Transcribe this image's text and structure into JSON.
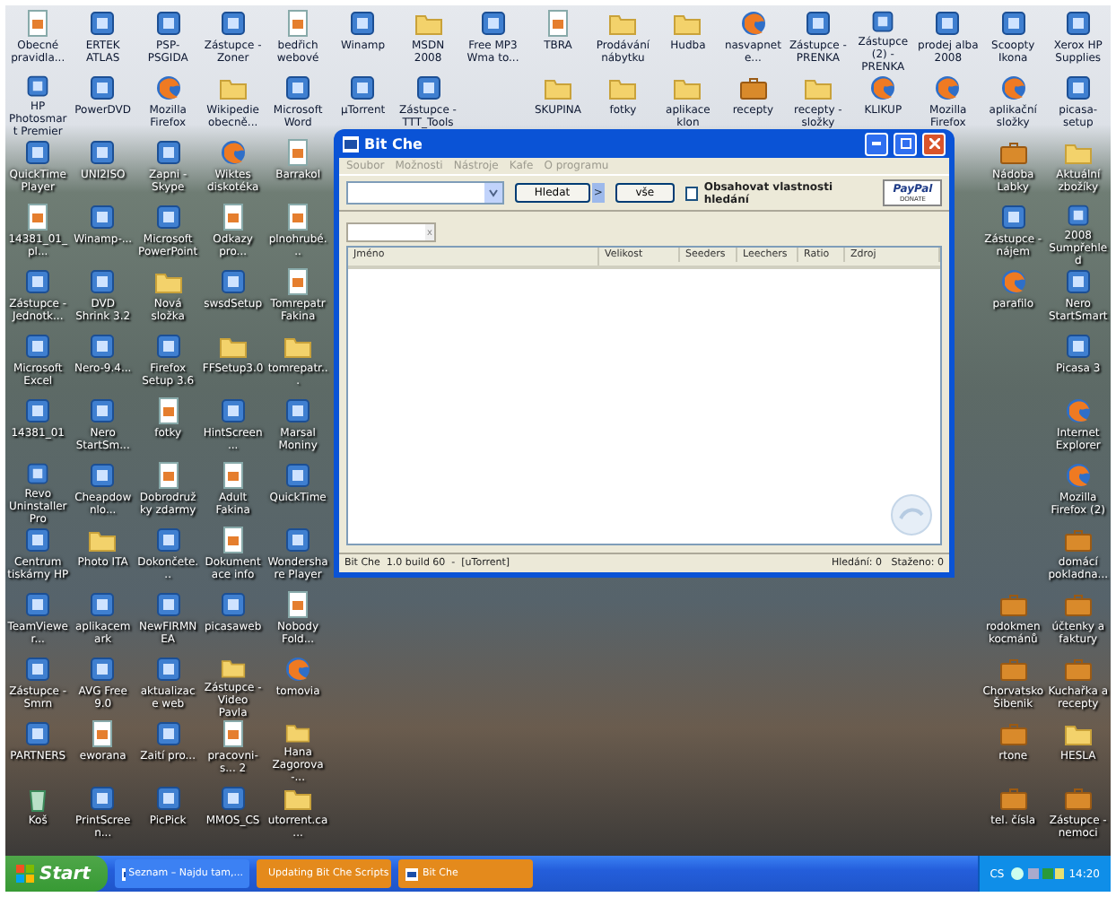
{
  "desktop": {
    "rows": [
      [
        {
          "label": "Obecné pravidla...",
          "kind": "document"
        },
        {
          "label": "ERTEK ATLAS",
          "kind": "program"
        },
        {
          "label": "PSP-PSGIDA",
          "kind": "program"
        },
        {
          "label": "Zástupce - Zoner",
          "kind": "program"
        },
        {
          "label": "bedřich webové",
          "kind": "document"
        },
        {
          "label": "Winamp",
          "kind": "program"
        },
        {
          "label": "MSDN 2008",
          "kind": "folder"
        },
        {
          "label": "Free MP3 Wma to...",
          "kind": "program"
        },
        {
          "label": "TBRA",
          "kind": "document"
        },
        {
          "label": "Prodávání nábytku",
          "kind": "folder"
        },
        {
          "label": "Hudba",
          "kind": "folder"
        },
        {
          "label": "nasvapnete...",
          "kind": "browser"
        },
        {
          "label": "Zástupce - PRENKA",
          "kind": "program"
        },
        {
          "label": "Zástupce (2) - PRENKA",
          "kind": "program"
        },
        {
          "label": "prodej alba 2008",
          "kind": "program"
        },
        {
          "label": "Scoopty Ikona",
          "kind": "program"
        },
        {
          "label": "Xerox HP Supplies",
          "kind": "program"
        }
      ],
      [
        {
          "label": "HP Photosmart Premier",
          "kind": "program"
        },
        {
          "label": "PowerDVD",
          "kind": "program"
        },
        {
          "label": "Mozilla Firefox",
          "kind": "browser"
        },
        {
          "label": "Wikipedie obecně...",
          "kind": "folder"
        },
        {
          "label": "Microsoft Word",
          "kind": "program"
        },
        {
          "label": "µTorrent",
          "kind": "program"
        },
        {
          "label": "Zástupce - TTT_Tools",
          "kind": "program"
        },
        null,
        {
          "label": "SKUPINA",
          "kind": "folder"
        },
        {
          "label": "fotky",
          "kind": "folder"
        },
        {
          "label": "aplikace klon",
          "kind": "folder"
        },
        {
          "label": "recepty",
          "kind": "briefcase"
        },
        {
          "label": "recepty - složky",
          "kind": "folder"
        },
        {
          "label": "KLIKUP",
          "kind": "browser"
        },
        {
          "label": "Mozilla Firefox",
          "kind": "browser"
        },
        {
          "label": "aplikační složky",
          "kind": "browser"
        },
        {
          "label": "picasa-setup",
          "kind": "program"
        }
      ],
      [
        {
          "label": "QuickTime Player",
          "kind": "program"
        },
        {
          "label": "UNI2ISO",
          "kind": "program"
        },
        {
          "label": "Zapni - Skype",
          "kind": "program"
        },
        {
          "label": "Wiktes diskotéka",
          "kind": "browser"
        },
        {
          "label": "Barrakol",
          "kind": "document"
        },
        null,
        null,
        null,
        null,
        null,
        null,
        null,
        null,
        null,
        null,
        {
          "label": "Nádoba Labky",
          "kind": "briefcase"
        },
        {
          "label": "Aktuální zbožíky",
          "kind": "folder"
        }
      ],
      [
        {
          "label": "14381_01_pl...",
          "kind": "document"
        },
        {
          "label": "Winamp-...",
          "kind": "program"
        },
        {
          "label": "Microsoft PowerPoint",
          "kind": "program"
        },
        {
          "label": "Odkazy pro...",
          "kind": "document"
        },
        {
          "label": "plnohrubé...",
          "kind": "document"
        },
        null,
        null,
        null,
        null,
        null,
        null,
        null,
        null,
        null,
        null,
        {
          "label": "Zástupce - nájem",
          "kind": "program"
        },
        {
          "label": "2008 Sumpřehled",
          "kind": "program"
        }
      ],
      [
        {
          "label": "Zástupce - Jednotk...",
          "kind": "program"
        },
        {
          "label": "DVD Shrink 3.2",
          "kind": "program"
        },
        {
          "label": "Nová složka",
          "kind": "folder"
        },
        {
          "label": "swsdSetup",
          "kind": "program"
        },
        {
          "label": "Tomrepatr Fakina",
          "kind": "document"
        },
        null,
        null,
        null,
        null,
        null,
        null,
        null,
        null,
        null,
        null,
        {
          "label": "parafilo",
          "kind": "browser"
        },
        {
          "label": "Nero StartSmart",
          "kind": "program"
        }
      ],
      [
        {
          "label": "Microsoft Excel",
          "kind": "program"
        },
        {
          "label": "Nero-9.4...",
          "kind": "program"
        },
        {
          "label": "Firefox Setup 3.6",
          "kind": "program"
        },
        {
          "label": "FFSetup3.0",
          "kind": "folder"
        },
        {
          "label": "tomrepatr...",
          "kind": "folder"
        },
        null,
        null,
        null,
        null,
        null,
        null,
        null,
        null,
        null,
        null,
        null,
        {
          "label": "Picasa 3",
          "kind": "program"
        }
      ],
      [
        {
          "label": "14381_01",
          "kind": "program"
        },
        {
          "label": "Nero StartSm...",
          "kind": "program"
        },
        {
          "label": "fotky",
          "kind": "document"
        },
        {
          "label": "HintScreen...",
          "kind": "program"
        },
        {
          "label": "Marsal Moniny",
          "kind": "program"
        },
        null,
        null,
        null,
        null,
        null,
        null,
        null,
        null,
        null,
        null,
        null,
        {
          "label": "Internet Explorer",
          "kind": "browser"
        }
      ],
      [
        {
          "label": "Revo Uninstaller Pro",
          "kind": "program"
        },
        {
          "label": "Cheapdownlo...",
          "kind": "program"
        },
        {
          "label": "Dobrodružky zdarmy",
          "kind": "document"
        },
        {
          "label": "Adult Fakina",
          "kind": "document"
        },
        {
          "label": "QuickTime",
          "kind": "program"
        },
        null,
        null,
        null,
        null,
        null,
        null,
        null,
        null,
        null,
        null,
        null,
        {
          "label": "Mozilla Firefox (2)",
          "kind": "browser"
        }
      ],
      [
        {
          "label": "Centrum tiskárny HP",
          "kind": "program"
        },
        {
          "label": "Photo ITA",
          "kind": "folder"
        },
        {
          "label": "Dokončete...",
          "kind": "program"
        },
        {
          "label": "Dokumentace info",
          "kind": "document"
        },
        {
          "label": "Wondershare Player",
          "kind": "program"
        },
        null,
        null,
        null,
        null,
        null,
        null,
        null,
        null,
        null,
        null,
        null,
        {
          "label": "domácí pokladna...",
          "kind": "briefcase"
        }
      ],
      [
        {
          "label": "TeamViewer...",
          "kind": "program"
        },
        {
          "label": "aplikacemark",
          "kind": "program"
        },
        {
          "label": "NewFIRMNEA",
          "kind": "program"
        },
        {
          "label": "picasaweb",
          "kind": "program"
        },
        {
          "label": "Nobody Fold...",
          "kind": "document"
        },
        null,
        null,
        null,
        null,
        null,
        null,
        null,
        null,
        null,
        null,
        {
          "label": "rodokmen kocmánů",
          "kind": "briefcase"
        },
        {
          "label": "účtenky a faktury",
          "kind": "briefcase"
        }
      ],
      [
        {
          "label": "Zástupce - Smrn",
          "kind": "program"
        },
        {
          "label": "AVG Free 9.0",
          "kind": "program"
        },
        {
          "label": "aktualizace web",
          "kind": "program"
        },
        {
          "label": "Zástupce - Video Pavla",
          "kind": "folder"
        },
        {
          "label": "tomovia",
          "kind": "browser"
        },
        null,
        null,
        null,
        null,
        null,
        null,
        null,
        null,
        null,
        null,
        {
          "label": "Chorvatsko Šibenik",
          "kind": "briefcase"
        },
        {
          "label": "Kuchařka a recepty",
          "kind": "briefcase"
        }
      ],
      [
        {
          "label": "PARTNERS",
          "kind": "program"
        },
        {
          "label": "eworana",
          "kind": "document"
        },
        {
          "label": "Zaití pro...",
          "kind": "program"
        },
        {
          "label": "pracovni-s... 2",
          "kind": "document"
        },
        {
          "label": "Hana Zagorova -...",
          "kind": "folder"
        },
        null,
        null,
        null,
        null,
        null,
        null,
        null,
        null,
        null,
        null,
        {
          "label": "rtone",
          "kind": "briefcase"
        },
        {
          "label": "HESLA",
          "kind": "folder"
        }
      ],
      [
        {
          "label": "Koš",
          "kind": "recycle"
        },
        {
          "label": "PrintScreen...",
          "kind": "program"
        },
        {
          "label": "PicPick",
          "kind": "program"
        },
        {
          "label": "MMOS_CS",
          "kind": "program"
        },
        {
          "label": "utorrent.ca...",
          "kind": "folder"
        },
        null,
        null,
        null,
        null,
        null,
        null,
        null,
        null,
        null,
        null,
        {
          "label": "tel. čísla",
          "kind": "briefcase"
        },
        {
          "label": "Zástupce - nemoci",
          "kind": "briefcase"
        }
      ]
    ]
  },
  "window": {
    "title": "Bit Che",
    "menu": [
      "Soubor",
      "Možnosti",
      "Nástroje",
      "Kafe",
      "O programu"
    ],
    "search_button": "Hledat",
    "next_button": ">",
    "all_button": "vše",
    "option": {
      "label": "Obsahovat vlastnosti hledání",
      "checked": false
    },
    "donate": {
      "brand": "PayPal",
      "label": "DONATE"
    },
    "filter_clear": "x",
    "columns": [
      "Jméno",
      "Velikost",
      "Seeders",
      "Leechers",
      "Ratio",
      "Zdroj"
    ],
    "status_left": "Bit Che  1.0 build 60  -  [uTorrent]",
    "status_right": "Hledání: 0   Staženo: 0"
  },
  "taskbar": {
    "start": "Start",
    "tasks": [
      {
        "label": "Seznam – Najdu tam,...",
        "highlighted": false
      },
      {
        "label": "Updating Bit Che Scripts",
        "highlighted": true
      },
      {
        "label": "Bit Che",
        "highlighted": true
      }
    ],
    "language": "CS",
    "clock": "14:20"
  }
}
